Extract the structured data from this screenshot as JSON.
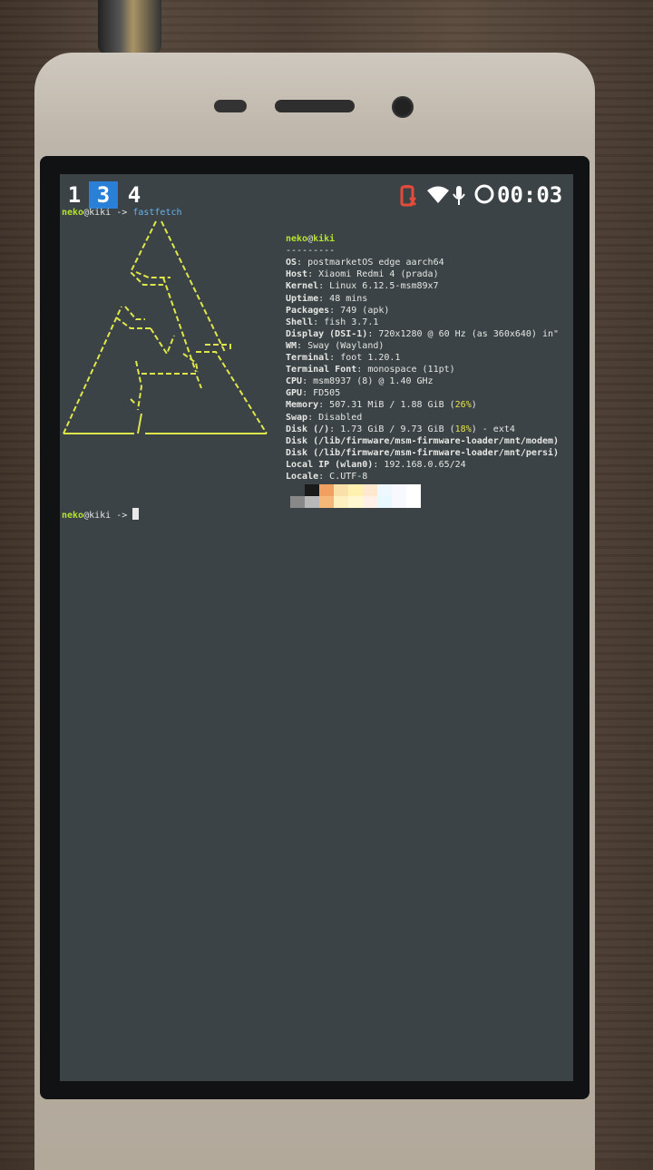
{
  "statusbar": {
    "workspaces": [
      {
        "label": "1",
        "active": false
      },
      {
        "label": "3",
        "active": true
      },
      {
        "label": "4",
        "active": false
      }
    ],
    "icons": [
      "battery-alert-icon",
      "wifi-icon",
      "microphone-icon",
      "circle-icon"
    ],
    "clock": "00:03"
  },
  "terminal": {
    "prompt_user": "neko",
    "prompt_host": "kiki",
    "prompt_arrow": "->",
    "command": "fastfetch",
    "second_prompt_user": "neko",
    "second_prompt_host": "kiki",
    "second_prompt_arrow": "->"
  },
  "fastfetch": {
    "title_user": "neko",
    "title_host": "kiki",
    "separator": "---------",
    "rows": [
      {
        "key": "OS",
        "value": "postmarketOS edge aarch64"
      },
      {
        "key": "Host",
        "value": "Xiaomi Redmi 4 (prada)"
      },
      {
        "key": "Kernel",
        "value": "Linux 6.12.5-msm89x7"
      },
      {
        "key": "Uptime",
        "value": "48 mins"
      },
      {
        "key": "Packages",
        "value": "749 (apk)"
      },
      {
        "key": "Shell",
        "value": "fish 3.7.1"
      },
      {
        "key": "Display (DSI-1)",
        "value": "720x1280 @ 60 Hz (as 360x640) in\""
      },
      {
        "key": "WM",
        "value": "Sway (Wayland)"
      },
      {
        "key": "Terminal",
        "value": "foot 1.20.1"
      },
      {
        "key": "Terminal Font",
        "value": "monospace (11pt)"
      },
      {
        "key": "CPU",
        "value": "msm8937 (8) @ 1.40 GHz"
      },
      {
        "key": "GPU",
        "value": "FD505"
      },
      {
        "key": "Memory",
        "value": "507.31 MiB / 1.88 GiB",
        "pct": "26%"
      },
      {
        "key": "Swap",
        "value": "Disabled"
      },
      {
        "key": "Disk (/)",
        "value": "1.73 GiB / 9.73 GiB",
        "pct": "18%",
        "tail": " - ext4"
      },
      {
        "key": "Disk (/lib/firmware/msm-firmware-loader/mnt/modem)",
        "value": ""
      },
      {
        "key": "Disk (/lib/firmware/msm-firmware-loader/mnt/persi)",
        "value": ""
      },
      {
        "key": "Local IP (wlan0)",
        "value": "192.168.0.65/24"
      },
      {
        "key": "Locale",
        "value": "C.UTF-8"
      }
    ],
    "palette_top": [
      "#3b4346",
      "#1a1a1a",
      "#f0a060",
      "#f8e0a8",
      "#fff2b0",
      "#ffe8d0",
      "#f0f8ff",
      "#f8f8ff",
      "#ffffff"
    ],
    "palette_bottom": [
      "#888888",
      "#b8b8b8",
      "#f4b878",
      "#fff0c0",
      "#fff8d0",
      "#fff0e8",
      "#e8f8ff",
      "#f8f8ff",
      "#ffffff"
    ]
  },
  "colors": {
    "user_green": "#b5e32b",
    "command_blue": "#66b4f0",
    "logo_yellow": "#dfe64a",
    "terminal_bg": "#3b4346",
    "workspace_active": "#2a7fd6"
  }
}
